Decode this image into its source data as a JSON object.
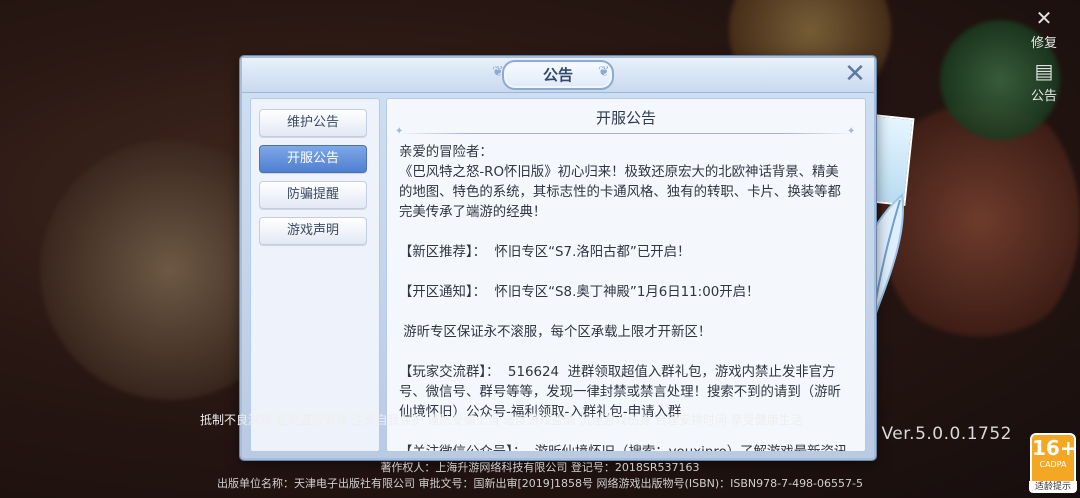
{
  "top_right": {
    "repair_label": "修复",
    "notice_label": "公告"
  },
  "version": "Ver.5.0.0.1752",
  "age_rating": {
    "number": "16+",
    "org": "CADPA",
    "tip": "适龄提示",
    "color": "#f5a623"
  },
  "footer": {
    "line0": "抵制不良游戏 拒绝盗版游戏 注意自我保护 谨防受骗上当 适度游戏益脑 沉迷游戏伤身 合理安排时间 享受健康生活",
    "line1": "著作权人：上海升游网络科技有限公司 登记号：2018SR537163",
    "line2": "出版单位名称：天津电子出版社有限公司 审批文号：国新出审[2019]1858号 网络游戏出版物号(ISBN)：ISBN978-7-498-06557-5"
  },
  "dialog": {
    "title": "公告",
    "close_icon": "close-icon",
    "tabs": [
      {
        "label": "维护公告",
        "active": false
      },
      {
        "label": "开服公告",
        "active": true
      },
      {
        "label": "防骗提醒",
        "active": false
      },
      {
        "label": "游戏声明",
        "active": false
      }
    ],
    "content": {
      "title": "开服公告",
      "paragraphs": [
        "亲爱的冒险者：\n《巴风特之怒-RO怀旧版》初心归来！极致还原宏大的北欧神话背景、精美的地图、特色的系统，其标志性的卡通风格、独有的转职、卡片、换装等都完美传承了端游的经典！",
        "【新区推荐】：  怀旧专区“S7.洛阳古都”已开启！",
        "【开区通知】：  怀旧专区“S8.奥丁神殿”1月6日11:00开启！",
        " 游昕专区保证永不滚服，每个区承载上限才开新区！",
        "【玩家交流群】：  516624  进群领取超值入群礼包，游戏内禁止发非官方号、微信号、群号等等，发现一律封禁或禁言处理！搜索不到的请到（游昕仙境怀旧）公众号-福利领取-入群礼包-申请入群",
        "【关注微信公众号】：  游昕仙境怀旧（搜索：vouxinro）了解游戏最新资讯"
      ]
    }
  },
  "colors": {
    "tab_active": "#4f7fd0",
    "dialog_bg": "#cfe0f4"
  }
}
